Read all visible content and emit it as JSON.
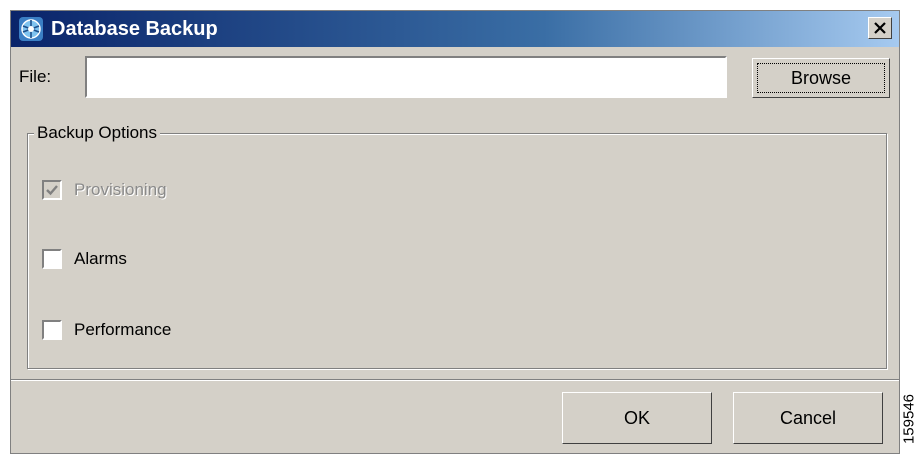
{
  "dialog": {
    "title": "Database Backup",
    "title_gradient": [
      "#0a246a",
      "#a6caf0"
    ],
    "icon": "database-app-icon",
    "close_icon": "close-icon"
  },
  "file": {
    "label": "File:",
    "value": "",
    "placeholder": "",
    "browse_label": "Browse"
  },
  "backup_options": {
    "legend": "Backup Options",
    "items": [
      {
        "label": "Provisioning",
        "checked": true,
        "enabled": false
      },
      {
        "label": "Alarms",
        "checked": false,
        "enabled": true
      },
      {
        "label": "Performance",
        "checked": false,
        "enabled": true
      }
    ]
  },
  "buttons": {
    "ok_label": "OK",
    "cancel_label": "Cancel"
  },
  "figure_id": "159546",
  "colors": {
    "window_bg": "#d4d0c8",
    "title_text": "#ffffff",
    "disabled_text": "#8a8a8a"
  }
}
